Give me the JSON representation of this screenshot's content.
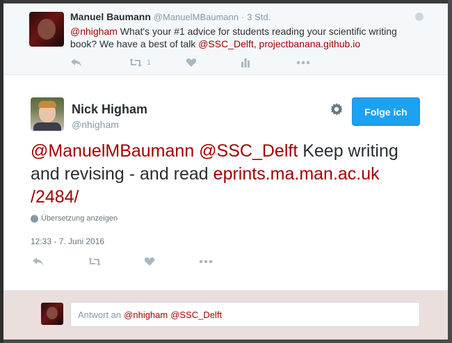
{
  "parent_tweet": {
    "name": "Manuel Baumann",
    "handle": "@ManuelMBaumann",
    "separator": "·",
    "time": "3 Std.",
    "mention": "@nhigham",
    "text_middle": " What's your #1 advice for students reading your scientific writing book? We have a best of talk ",
    "link_ssc": "@SSC_Delft",
    "comma": ", ",
    "link_url": "projectbanana.github.io",
    "retweet_count": "1"
  },
  "tweet": {
    "name": "Nick Higham",
    "handle": "@nhigham",
    "follow_label": "Folge ich",
    "mention1": "@ManuelMBaumann",
    "mention2": "@SSC_Delft",
    "text_plain": " Keep writing and revising - and read ",
    "link_part1": "eprints.ma.man.ac.uk",
    "link_part2": "/2484/",
    "translate_label": "Übersetzung anzeigen",
    "timestamp": "12:33 - 7. Juni 2016"
  },
  "reply": {
    "prefix": "Antwort an",
    "mention1": "@nhigham",
    "mention2": "@SSC_Delft"
  },
  "icons": {
    "reply": "reply-icon",
    "retweet": "retweet-icon",
    "like": "heart-icon",
    "analytics": "analytics-icon",
    "more": "more-icon",
    "gear": "gear-icon",
    "globe": "globe-icon"
  },
  "colors": {
    "link": "#a30000",
    "follow_button": "#1da1f2",
    "reply_bg": "#eadfdd"
  }
}
